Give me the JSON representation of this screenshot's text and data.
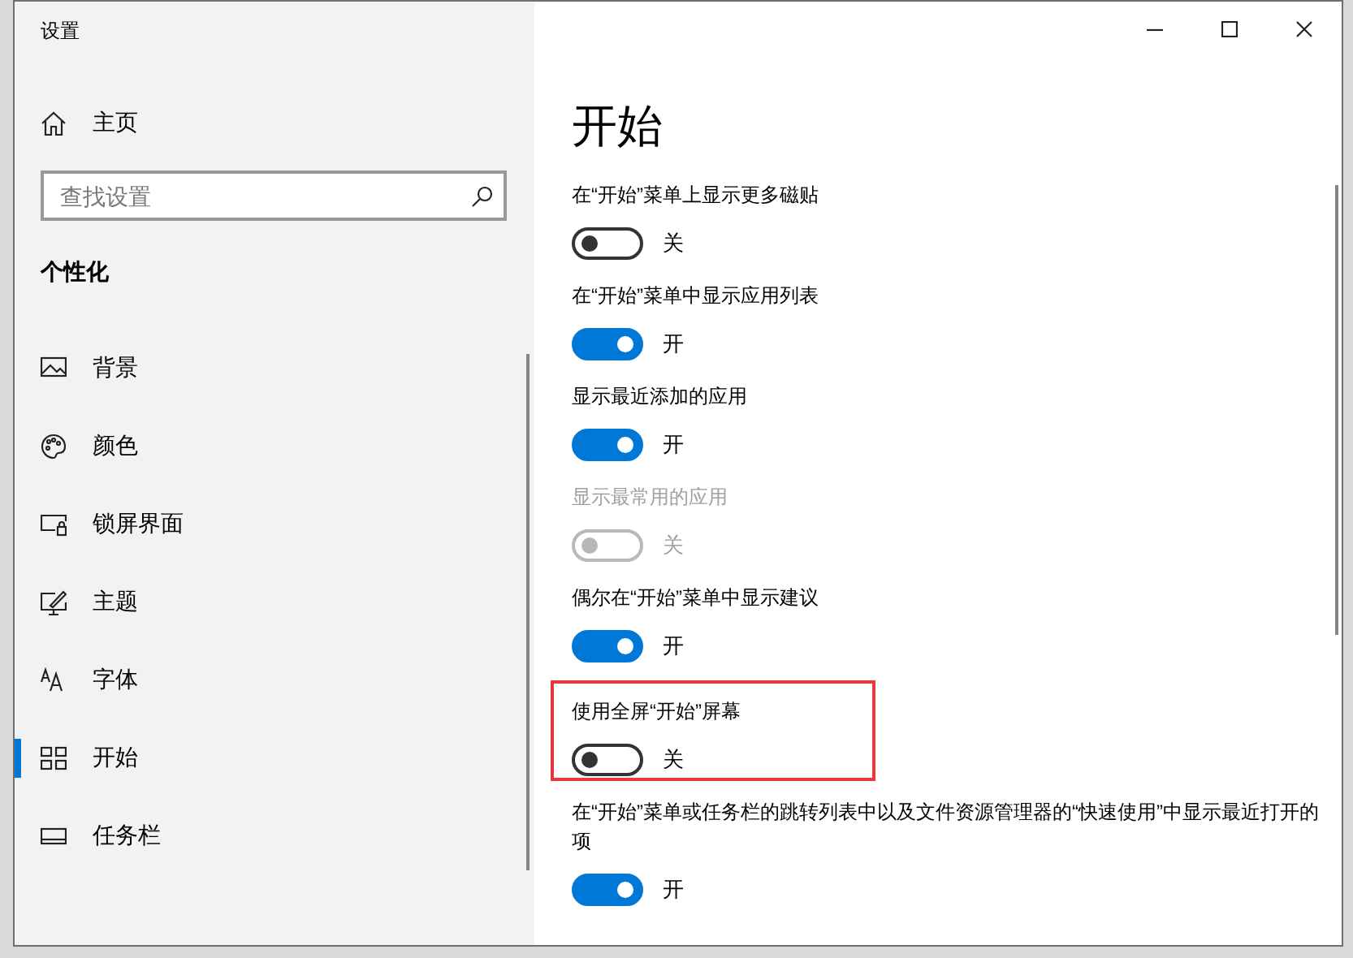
{
  "window": {
    "title": "设置"
  },
  "sidebar": {
    "home": "主页",
    "search": {
      "placeholder": "查找设置"
    },
    "section": "个性化",
    "items": [
      {
        "label": "背景",
        "selected": false
      },
      {
        "label": "颜色",
        "selected": false
      },
      {
        "label": "锁屏界面",
        "selected": false
      },
      {
        "label": "主题",
        "selected": false
      },
      {
        "label": "字体",
        "selected": false
      },
      {
        "label": "开始",
        "selected": true
      },
      {
        "label": "任务栏",
        "selected": false
      }
    ]
  },
  "page": {
    "heading": "开始",
    "settings": [
      {
        "label": "在“开始”菜单上显示更多磁贴",
        "on": false,
        "state": "关",
        "disabled": false,
        "highlighted": false
      },
      {
        "label": "在“开始”菜单中显示应用列表",
        "on": true,
        "state": "开",
        "disabled": false,
        "highlighted": false
      },
      {
        "label": "显示最近添加的应用",
        "on": true,
        "state": "开",
        "disabled": false,
        "highlighted": false
      },
      {
        "label": "显示最常用的应用",
        "on": false,
        "state": "关",
        "disabled": true,
        "highlighted": false
      },
      {
        "label": "偶尔在“开始”菜单中显示建议",
        "on": true,
        "state": "开",
        "disabled": false,
        "highlighted": false
      },
      {
        "label": "使用全屏“开始”屏幕",
        "on": false,
        "state": "关",
        "disabled": false,
        "highlighted": true
      },
      {
        "label": "在“开始”菜单或任务栏的跳转列表中以及文件资源管理器的“快速使用”中显示最近打开的项",
        "on": true,
        "state": "开",
        "disabled": false,
        "highlighted": false
      }
    ]
  }
}
